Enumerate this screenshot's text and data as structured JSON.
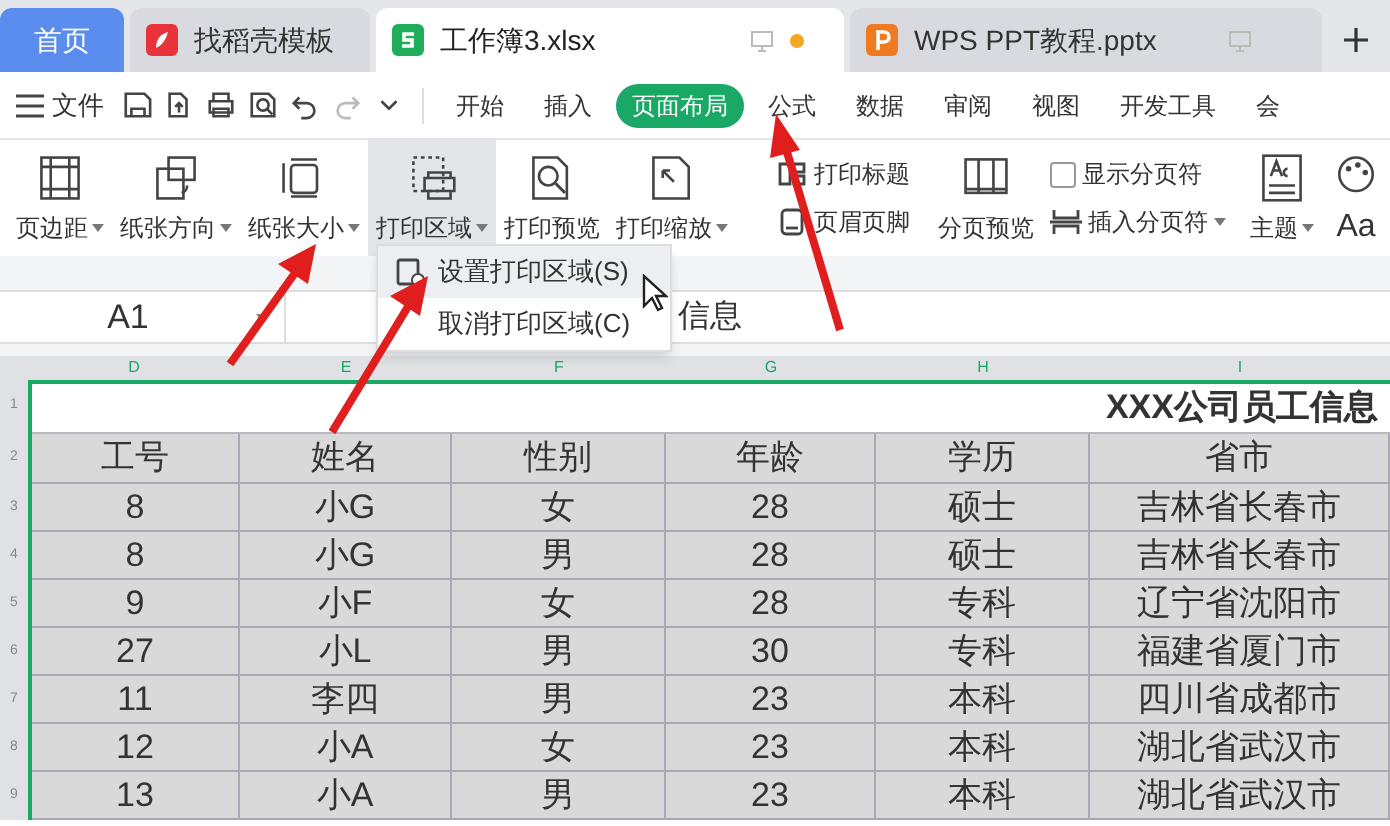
{
  "tabs": [
    {
      "kind": "home",
      "label": "首页",
      "selected": false,
      "unsaved": false
    },
    {
      "kind": "docer",
      "label": "找稻壳模板",
      "selected": false,
      "unsaved": false
    },
    {
      "kind": "sheet",
      "label": "工作簿3.xlsx",
      "selected": true,
      "unsaved": true
    },
    {
      "kind": "slides",
      "label": "WPS PPT教程.pptx",
      "selected": false,
      "unsaved": false
    }
  ],
  "menu": {
    "file": "文件",
    "tabs": [
      {
        "label": "开始",
        "selected": false
      },
      {
        "label": "插入",
        "selected": false
      },
      {
        "label": "页面布局",
        "selected": true
      },
      {
        "label": "公式",
        "selected": false
      },
      {
        "label": "数据",
        "selected": false
      },
      {
        "label": "审阅",
        "selected": false
      },
      {
        "label": "视图",
        "selected": false
      },
      {
        "label": "开发工具",
        "selected": false
      },
      {
        "label": "会",
        "selected": false
      }
    ]
  },
  "ribbon": [
    {
      "kind": "large",
      "label": "页边距",
      "has_menu": true,
      "pressed": false
    },
    {
      "kind": "large",
      "label": "纸张方向",
      "has_menu": true,
      "pressed": false
    },
    {
      "kind": "large",
      "label": "纸张大小",
      "has_menu": true,
      "pressed": false
    },
    {
      "kind": "large",
      "label": "打印区域",
      "has_menu": true,
      "pressed": true
    },
    {
      "kind": "large",
      "label": "打印预览",
      "has_menu": false,
      "pressed": false
    },
    {
      "kind": "large",
      "label": "打印缩放",
      "has_menu": true,
      "pressed": false
    },
    {
      "kind": "stack",
      "items": [
        {
          "kind": "button",
          "label": "打印标题",
          "has_menu": false
        },
        {
          "kind": "button",
          "label": "页眉页脚",
          "has_menu": false
        }
      ]
    },
    {
      "kind": "large",
      "label": "分页预览",
      "has_menu": false,
      "pressed": false
    },
    {
      "kind": "stack",
      "items": [
        {
          "kind": "checkbox",
          "label": "显示分页符",
          "checked": false
        },
        {
          "kind": "button",
          "label": "插入分页符",
          "has_menu": true
        }
      ]
    },
    {
      "kind": "large",
      "label": "主题",
      "has_menu": true,
      "pressed": false
    },
    {
      "kind": "large",
      "label": "Aa",
      "has_menu": false,
      "pressed": false
    }
  ],
  "dropdown": {
    "items": [
      {
        "label": "设置打印区域(S)",
        "highlighted": true
      },
      {
        "label": "取消打印区域(C)",
        "highlighted": false
      }
    ]
  },
  "name_box": "A1",
  "formula": "信息",
  "column_headers": [
    "D",
    "E",
    "F",
    "G",
    "H",
    "I"
  ],
  "row_numbers": [
    "1",
    "2",
    "3",
    "4",
    "5",
    "6",
    "7",
    "8",
    "9"
  ],
  "sheet": {
    "title": "XXX公司员工信息",
    "columns": [
      "工号",
      "姓名",
      "性别",
      "年龄",
      "学历",
      "省市"
    ],
    "rows": [
      [
        "8",
        "小G",
        "女",
        "28",
        "硕士",
        "吉林省长春市"
      ],
      [
        "8",
        "小G",
        "男",
        "28",
        "硕士",
        "吉林省长春市"
      ],
      [
        "9",
        "小F",
        "女",
        "28",
        "专科",
        "辽宁省沈阳市"
      ],
      [
        "27",
        "小L",
        "男",
        "30",
        "专科",
        "福建省厦门市"
      ],
      [
        "11",
        "李四",
        "男",
        "23",
        "本科",
        "四川省成都市"
      ],
      [
        "12",
        "小A",
        "女",
        "23",
        "本科",
        "湖北省武汉市"
      ],
      [
        "13",
        "小A",
        "男",
        "23",
        "本科",
        "湖北省武汉市"
      ]
    ]
  }
}
